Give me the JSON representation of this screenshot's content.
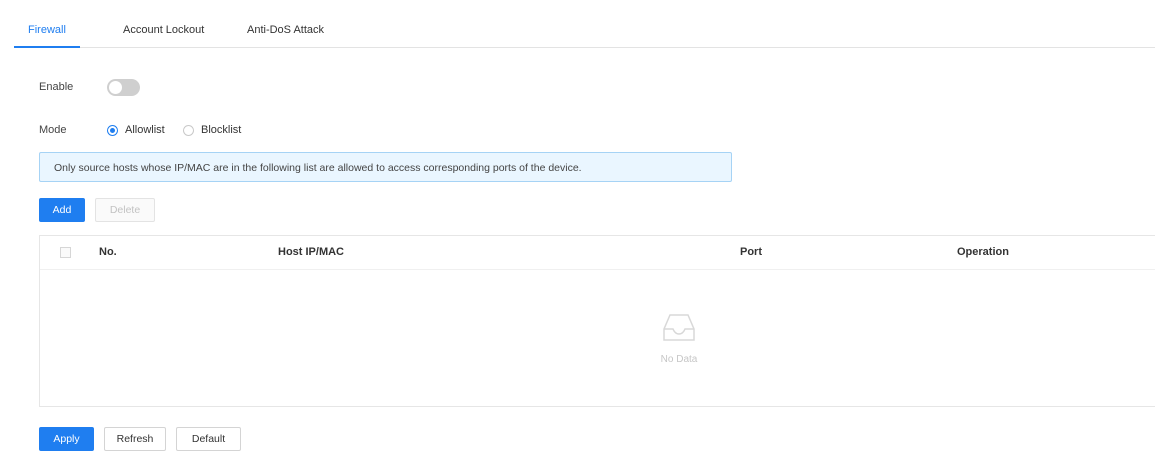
{
  "tabs": [
    {
      "label": "Firewall",
      "active": true
    },
    {
      "label": "Account Lockout",
      "active": false
    },
    {
      "label": "Anti-DoS Attack",
      "active": false
    }
  ],
  "form": {
    "enable_label": "Enable",
    "enable_on": false,
    "mode_label": "Mode",
    "mode_options": [
      {
        "label": "Allowlist",
        "selected": true
      },
      {
        "label": "Blocklist",
        "selected": false
      }
    ]
  },
  "info_message": "Only source hosts whose IP/MAC are in the following list are allowed to access corresponding ports of the device.",
  "toolbar": {
    "add_label": "Add",
    "delete_label": "Delete"
  },
  "table": {
    "columns": [
      "No.",
      "Host IP/MAC",
      "Port",
      "Operation"
    ],
    "rows": [],
    "empty_text": "No Data"
  },
  "footer": {
    "apply_label": "Apply",
    "refresh_label": "Refresh",
    "default_label": "Default"
  },
  "colors": {
    "accent": "#1f7ef0",
    "info_bg": "#eaf6ff",
    "info_border": "#a6d3f5"
  },
  "icons": {
    "empty": "empty-inbox-icon"
  }
}
